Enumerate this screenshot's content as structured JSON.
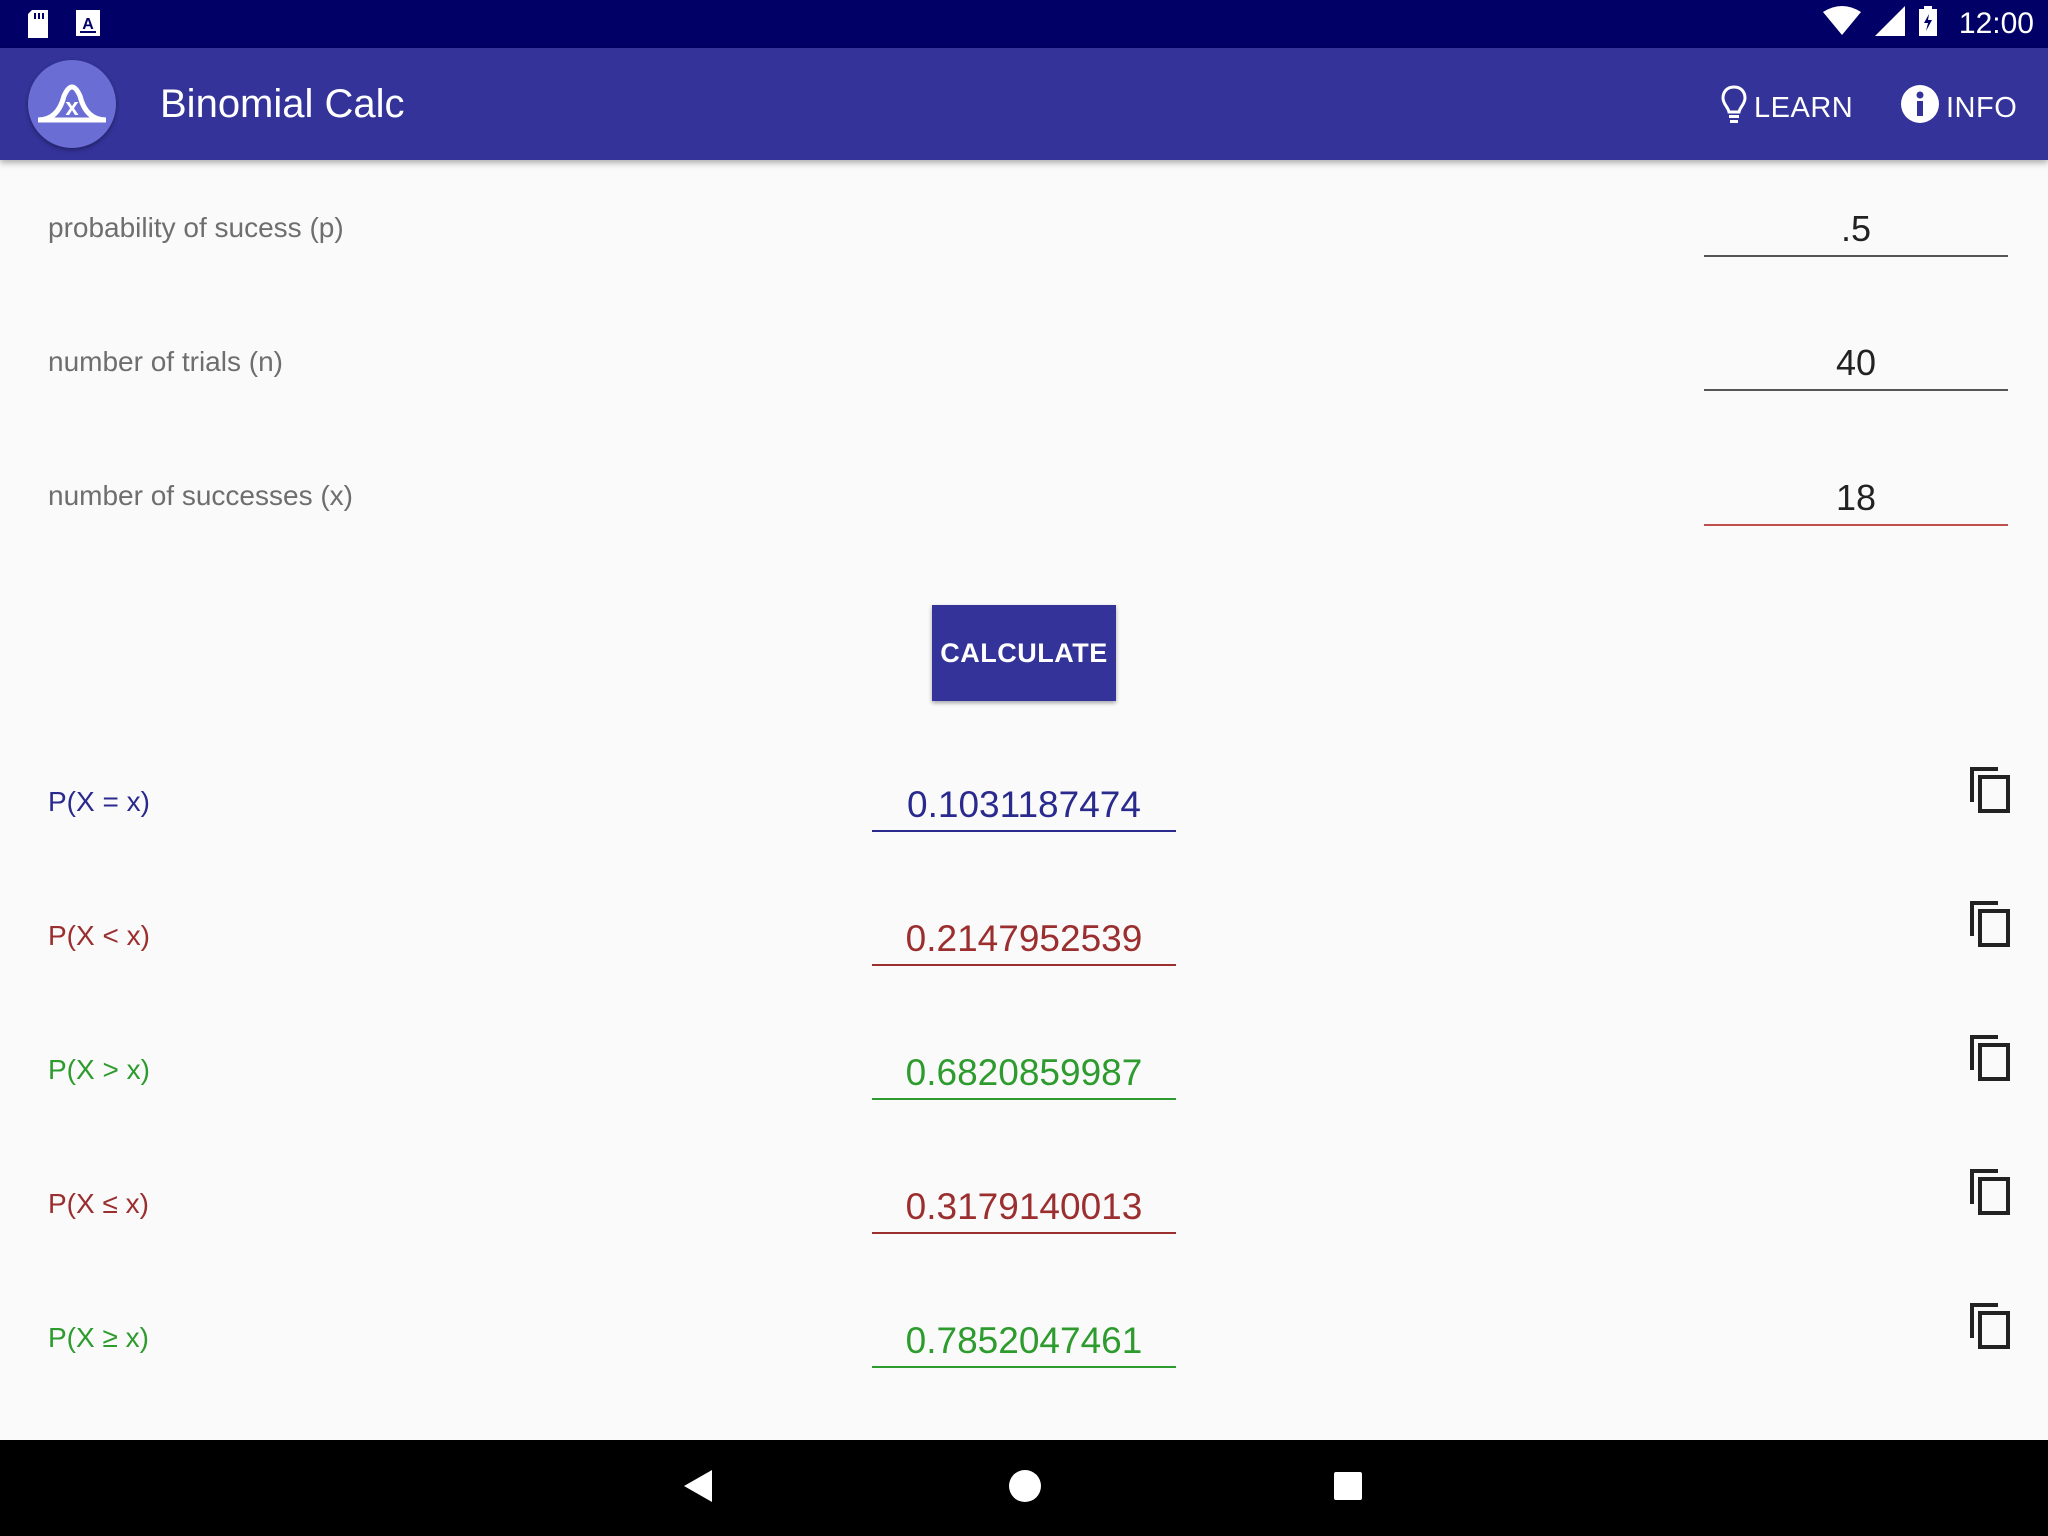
{
  "status_bar": {
    "time": "12:00",
    "icons": [
      "sd-card-icon",
      "keyboard-a-icon",
      "wifi-icon",
      "signal-icon",
      "battery-icon"
    ]
  },
  "app_bar": {
    "title": "Binomial Calc",
    "logo_letter": "x",
    "learn_label": "LEARN",
    "info_label": "INFO",
    "color": "#333399"
  },
  "inputs": {
    "p": {
      "label": "probability of sucess (p)",
      "value": ".5"
    },
    "n": {
      "label": "number of trials (n)",
      "value": "40"
    },
    "x": {
      "label": "number of successes (x)",
      "value": "18"
    }
  },
  "calculate_label": "CALCULATE",
  "results": [
    {
      "label": "P(X = x)",
      "value": "0.1031187474",
      "color": "#2a2a8e"
    },
    {
      "label": "P(X < x)",
      "value": "0.2147952539",
      "color": "#9b2e2e"
    },
    {
      "label": "P(X > x)",
      "value": "0.6820859987",
      "color": "#2e9b2e"
    },
    {
      "label": "P(X ≤ x)",
      "value": "0.3179140013",
      "color": "#9b2e2e"
    },
    {
      "label": "P(X ≥ x)",
      "value": "0.7852047461",
      "color": "#2e9b2e"
    }
  ],
  "nav_bar": {
    "buttons": [
      "back-icon",
      "home-icon",
      "recents-icon"
    ]
  }
}
